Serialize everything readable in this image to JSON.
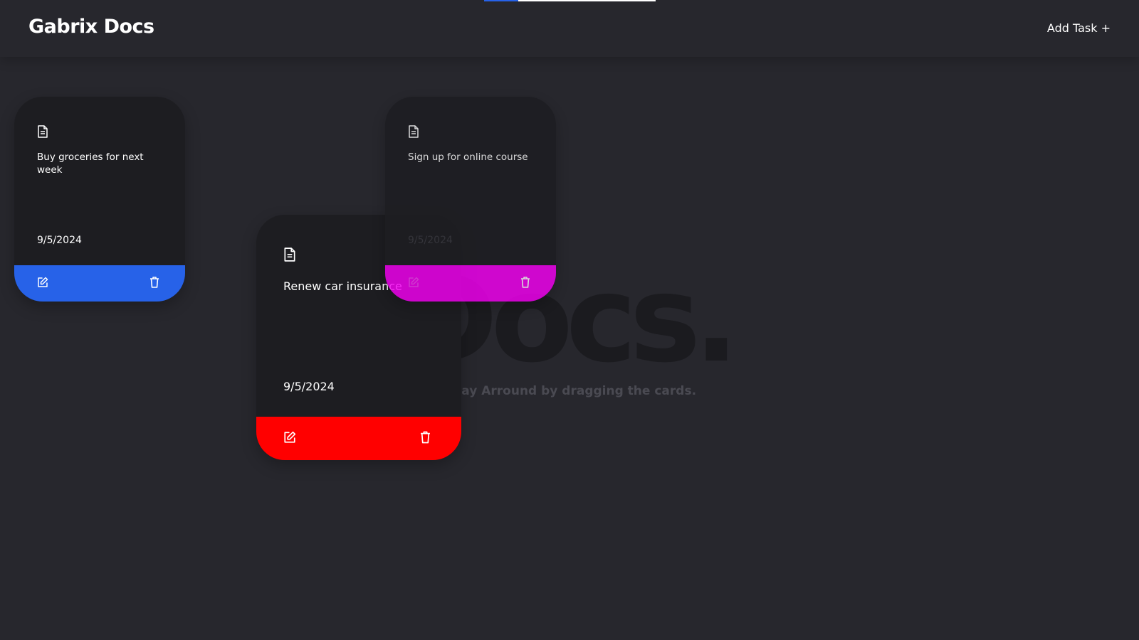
{
  "app": {
    "brand": "Gabrix Docs",
    "add_task_label": "Add Task +"
  },
  "colors": {
    "background": "#27272d",
    "card": "#1d1d21",
    "blue": "#2762e8",
    "red": "#ff0000",
    "magenta": "#f400f2",
    "top_bar_accent": "#2762e8",
    "top_bar_white": "#ffffff"
  },
  "hero": {
    "word": "Docs.",
    "subtitle": "Play Arround by dragging the cards."
  },
  "cards": [
    {
      "title": "Buy groceries for next week",
      "date": "9/5/2024",
      "color": "#2762e8",
      "edit_icon": "edit-icon",
      "delete_icon": "trash-icon"
    },
    {
      "title": "Sign up for online course",
      "date": "9/5/2024",
      "color": "#f400f2",
      "edit_icon": "edit-icon",
      "delete_icon": "trash-icon"
    },
    {
      "title": "Renew car insurance",
      "date": "9/5/2024",
      "color": "#ff0000",
      "edit_icon": "edit-icon",
      "delete_icon": "trash-icon"
    }
  ]
}
